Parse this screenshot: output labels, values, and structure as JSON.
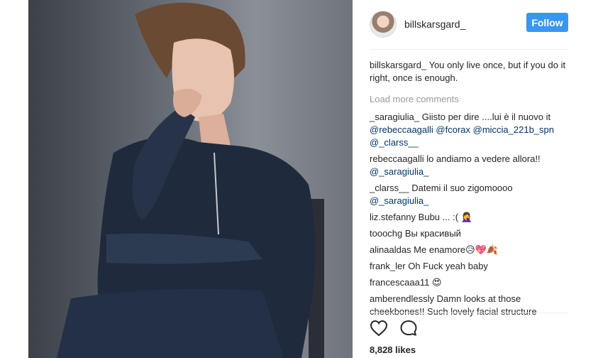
{
  "post": {
    "username": "billskarsgard_",
    "follow_label": "Follow",
    "caption_user": "billskarsgard_",
    "caption_text": "You only live once, but if you do it right, once is enough.",
    "load_more": "Load more comments",
    "likes": "8,828 likes"
  },
  "comments": [
    {
      "user": "_saragiulia_",
      "text": "Giisto per dire ....lui è il nuovo it",
      "mentions": "@rebeccaagalli @fcorax @miccia_221b_spn @_clarss__"
    },
    {
      "user": "rebeccaagalli",
      "text": "lo andiamo a vedere allora!!",
      "mentions": "@_saragiulia_"
    },
    {
      "user": "_clarss__",
      "text": "Datemi il suo zigomoooo",
      "mentions": "@_saragiulia_"
    },
    {
      "user": "liz.stefanny",
      "text": "Bubu ... :( 🤦‍♀️",
      "mentions": ""
    },
    {
      "user": "tooochg",
      "text": "Вы красивый",
      "mentions": ""
    },
    {
      "user": "alinaaldas",
      "text": "Me enamore😥💖🍂",
      "mentions": ""
    },
    {
      "user": "frank_ler",
      "text": "Oh Fuck yeah baby",
      "mentions": ""
    },
    {
      "user": "francescaaa11",
      "text": "😍",
      "mentions": ""
    },
    {
      "user": "amberendlessly",
      "text": "Damn looks at those cheekbones!! Such lovely facial structure",
      "mentions": ""
    }
  ],
  "icons": {
    "like": "heart-icon",
    "comment": "comment-bubble-icon"
  },
  "colors": {
    "follow_button": "#3897f0",
    "mention": "#003569",
    "muted": "#999999"
  }
}
